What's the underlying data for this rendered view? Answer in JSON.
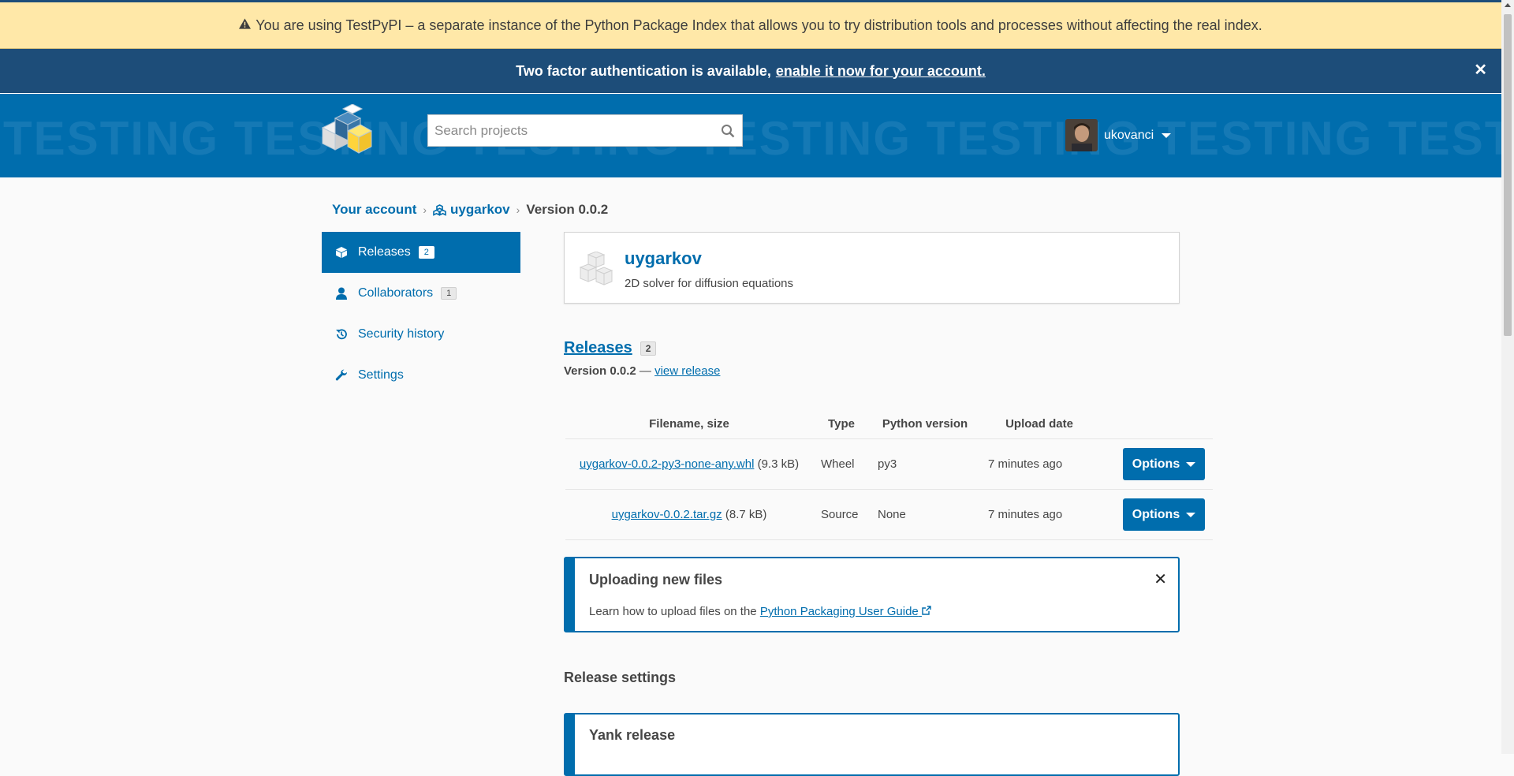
{
  "banners": {
    "testpypi": "You are using TestPyPI – a separate instance of the Python Package Index that allows you to try distribution tools and processes without affecting the real index.",
    "tfa_text": "Two factor authentication is available,",
    "tfa_link": "enable it now for your account.",
    "tfa_close": "✕"
  },
  "header": {
    "watermark": "TESTING TESTING TESTING TESTING TESTING TESTING TESTING TESTING",
    "search_placeholder": "Search projects",
    "username": "ukovanci"
  },
  "breadcrumb": {
    "account": "Your account",
    "project": "uygarkov",
    "current": "Version 0.0.2"
  },
  "sidebar": {
    "items": [
      {
        "label": "Releases",
        "count": "2",
        "icon": "box-icon"
      },
      {
        "label": "Collaborators",
        "count": "1",
        "icon": "user-icon"
      },
      {
        "label": "Security history",
        "icon": "history-icon"
      },
      {
        "label": "Settings",
        "icon": "wrench-icon"
      }
    ]
  },
  "project": {
    "name": "uygarkov",
    "description": "2D solver for diffusion equations"
  },
  "releases": {
    "heading": "Releases",
    "count": "2",
    "version_label": "Version 0.0.2",
    "dash": "—",
    "view_release": "view release",
    "columns": [
      "Filename, size",
      "Type",
      "Python version",
      "Upload date"
    ],
    "files": [
      {
        "filename": "uygarkov-0.0.2-py3-none-any.whl",
        "size": "(9.3 kB)",
        "type": "Wheel",
        "python": "py3",
        "date": "7 minutes ago",
        "options": "Options"
      },
      {
        "filename": "uygarkov-0.0.2.tar.gz",
        "size": "(8.7 kB)",
        "type": "Source",
        "python": "None",
        "date": "7 minutes ago",
        "options": "Options"
      }
    ]
  },
  "upload": {
    "title": "Uploading new files",
    "text": "Learn how to upload files on the",
    "link": "Python Packaging User Guide",
    "close": "✕"
  },
  "release_settings": {
    "heading": "Release settings",
    "yank_title": "Yank release"
  },
  "colors": {
    "primary": "#006dad",
    "dark_banner": "#1d4d79",
    "warning_banner": "#ffe8a8"
  }
}
